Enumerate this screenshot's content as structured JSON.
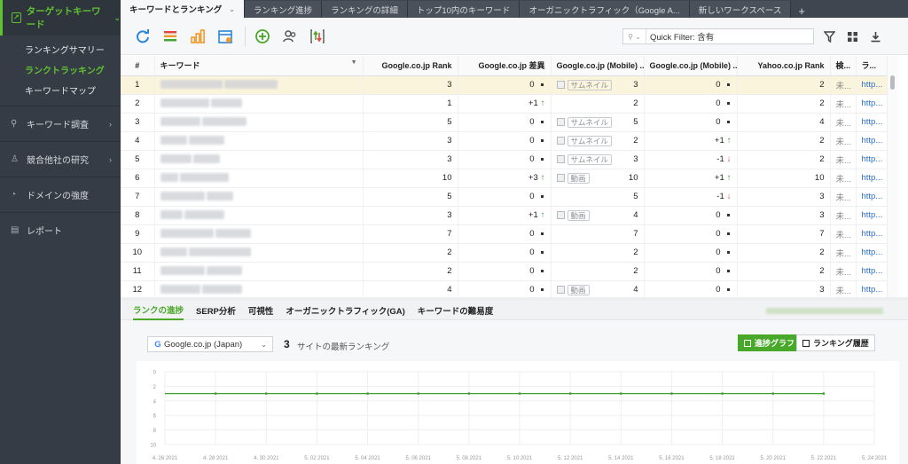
{
  "sidebar": {
    "head": "ターゲットキーワード",
    "sub_items": [
      "ランキングサマリー",
      "ランクトラッキング",
      "キーワードマップ"
    ],
    "sections": [
      "キーワード調査",
      "競合他社の研究",
      "ドメインの強度",
      "レポート"
    ]
  },
  "tabs": [
    "キーワードとランキング",
    "ランキング進捗",
    "ランキングの詳細",
    "トップ10内のキーワード",
    "オーガニックトラフィック（Google A...",
    "新しいワークスペース"
  ],
  "toolbar": {
    "filter_placeholder": "Quick Filter: 含有"
  },
  "table": {
    "headers": [
      "#",
      "キーワード",
      "Google.co.jp Rank",
      "Google.co.jp 差異",
      "Google.co.jp (Mobile) ...",
      "Google.co.jp (Mobile) ...",
      "Yahoo.co.jp Rank",
      "検...",
      "ラ..."
    ],
    "rows": [
      {
        "n": "1",
        "g": "3",
        "gd": "0",
        "gdir": "",
        "mt": "サムネイル",
        "m": "3",
        "md": "0",
        "mdir": "",
        "y": "2",
        "k": "未...",
        "u": "http..."
      },
      {
        "n": "2",
        "g": "1",
        "gd": "+1",
        "gdir": "up",
        "mt": "",
        "m": "2",
        "md": "0",
        "mdir": "",
        "y": "2",
        "k": "未...",
        "u": "http..."
      },
      {
        "n": "3",
        "g": "5",
        "gd": "0",
        "gdir": "",
        "mt": "サムネイル",
        "m": "5",
        "md": "0",
        "mdir": "",
        "y": "4",
        "k": "未...",
        "u": "http..."
      },
      {
        "n": "4",
        "g": "3",
        "gd": "0",
        "gdir": "",
        "mt": "サムネイル",
        "m": "2",
        "md": "+1",
        "mdir": "up",
        "y": "2",
        "k": "未...",
        "u": "http..."
      },
      {
        "n": "5",
        "g": "3",
        "gd": "0",
        "gdir": "",
        "mt": "サムネイル",
        "m": "3",
        "md": "-1",
        "mdir": "down",
        "y": "2",
        "k": "未...",
        "u": "http..."
      },
      {
        "n": "6",
        "g": "10",
        "gd": "+3",
        "gdir": "up",
        "mt": "動画",
        "m": "10",
        "md": "+1",
        "mdir": "up",
        "y": "10",
        "k": "未...",
        "u": "http..."
      },
      {
        "n": "7",
        "g": "5",
        "gd": "0",
        "gdir": "",
        "mt": "",
        "m": "5",
        "md": "-1",
        "mdir": "down",
        "y": "3",
        "k": "未...",
        "u": "http..."
      },
      {
        "n": "8",
        "g": "3",
        "gd": "+1",
        "gdir": "up",
        "mt": "動画",
        "m": "4",
        "md": "0",
        "mdir": "",
        "y": "3",
        "k": "未...",
        "u": "http..."
      },
      {
        "n": "9",
        "g": "7",
        "gd": "0",
        "gdir": "",
        "mt": "",
        "m": "7",
        "md": "0",
        "mdir": "",
        "y": "7",
        "k": "未...",
        "u": "http..."
      },
      {
        "n": "10",
        "g": "2",
        "gd": "0",
        "gdir": "",
        "mt": "",
        "m": "2",
        "md": "0",
        "mdir": "",
        "y": "2",
        "k": "未...",
        "u": "http..."
      },
      {
        "n": "11",
        "g": "2",
        "gd": "0",
        "gdir": "",
        "mt": "",
        "m": "2",
        "md": "0",
        "mdir": "",
        "y": "2",
        "k": "未...",
        "u": "http..."
      },
      {
        "n": "12",
        "g": "4",
        "gd": "0",
        "gdir": "",
        "mt": "動画",
        "m": "4",
        "md": "0",
        "mdir": "",
        "y": "3",
        "k": "未...",
        "u": "http..."
      }
    ]
  },
  "bottom_tabs": [
    "ランクの進捗",
    "SERP分析",
    "可視性",
    "オーガニックトラフィック(GA)",
    "キーワードの難易度"
  ],
  "bottom": {
    "engine": "Google.co.jp (Japan)",
    "count": "3",
    "count_label": "サイトの最新ランキング",
    "graph_btn": "進捗グラフ",
    "history_btn": "ランキング履歴"
  },
  "chart_data": {
    "type": "line",
    "x": [
      "4. 26 2021",
      "4. 28 2021",
      "4. 30 2021",
      "5. 02 2021",
      "5. 04 2021",
      "5. 06 2021",
      "5. 08 2021",
      "5. 10 2021",
      "5. 12 2021",
      "5. 14 2021",
      "5. 16 2021",
      "5. 18 2021",
      "5. 20 2021",
      "5. 22 2021",
      "5. 24 2021"
    ],
    "y_ticks": [
      "0",
      "2",
      "4",
      "6",
      "8",
      "10"
    ],
    "ylim": [
      0,
      10
    ],
    "y_inverted": true,
    "series": [
      {
        "color": "#3aa22a",
        "points_x": [
          0,
          0.5,
          1,
          1.5,
          2,
          2.5,
          3,
          3.5,
          4,
          4.5,
          5,
          5.5,
          6,
          6.5,
          7,
          7.5,
          8,
          8.5,
          9,
          9.5,
          10,
          10.5,
          11,
          11.5,
          12,
          12.5,
          13
        ],
        "values": [
          3,
          3,
          3,
          3,
          3,
          3,
          3,
          3,
          3,
          3,
          3,
          3,
          3,
          3,
          3,
          3,
          3,
          3,
          3,
          3,
          3,
          3,
          3,
          3,
          3,
          3,
          3
        ]
      }
    ],
    "grid": true
  }
}
